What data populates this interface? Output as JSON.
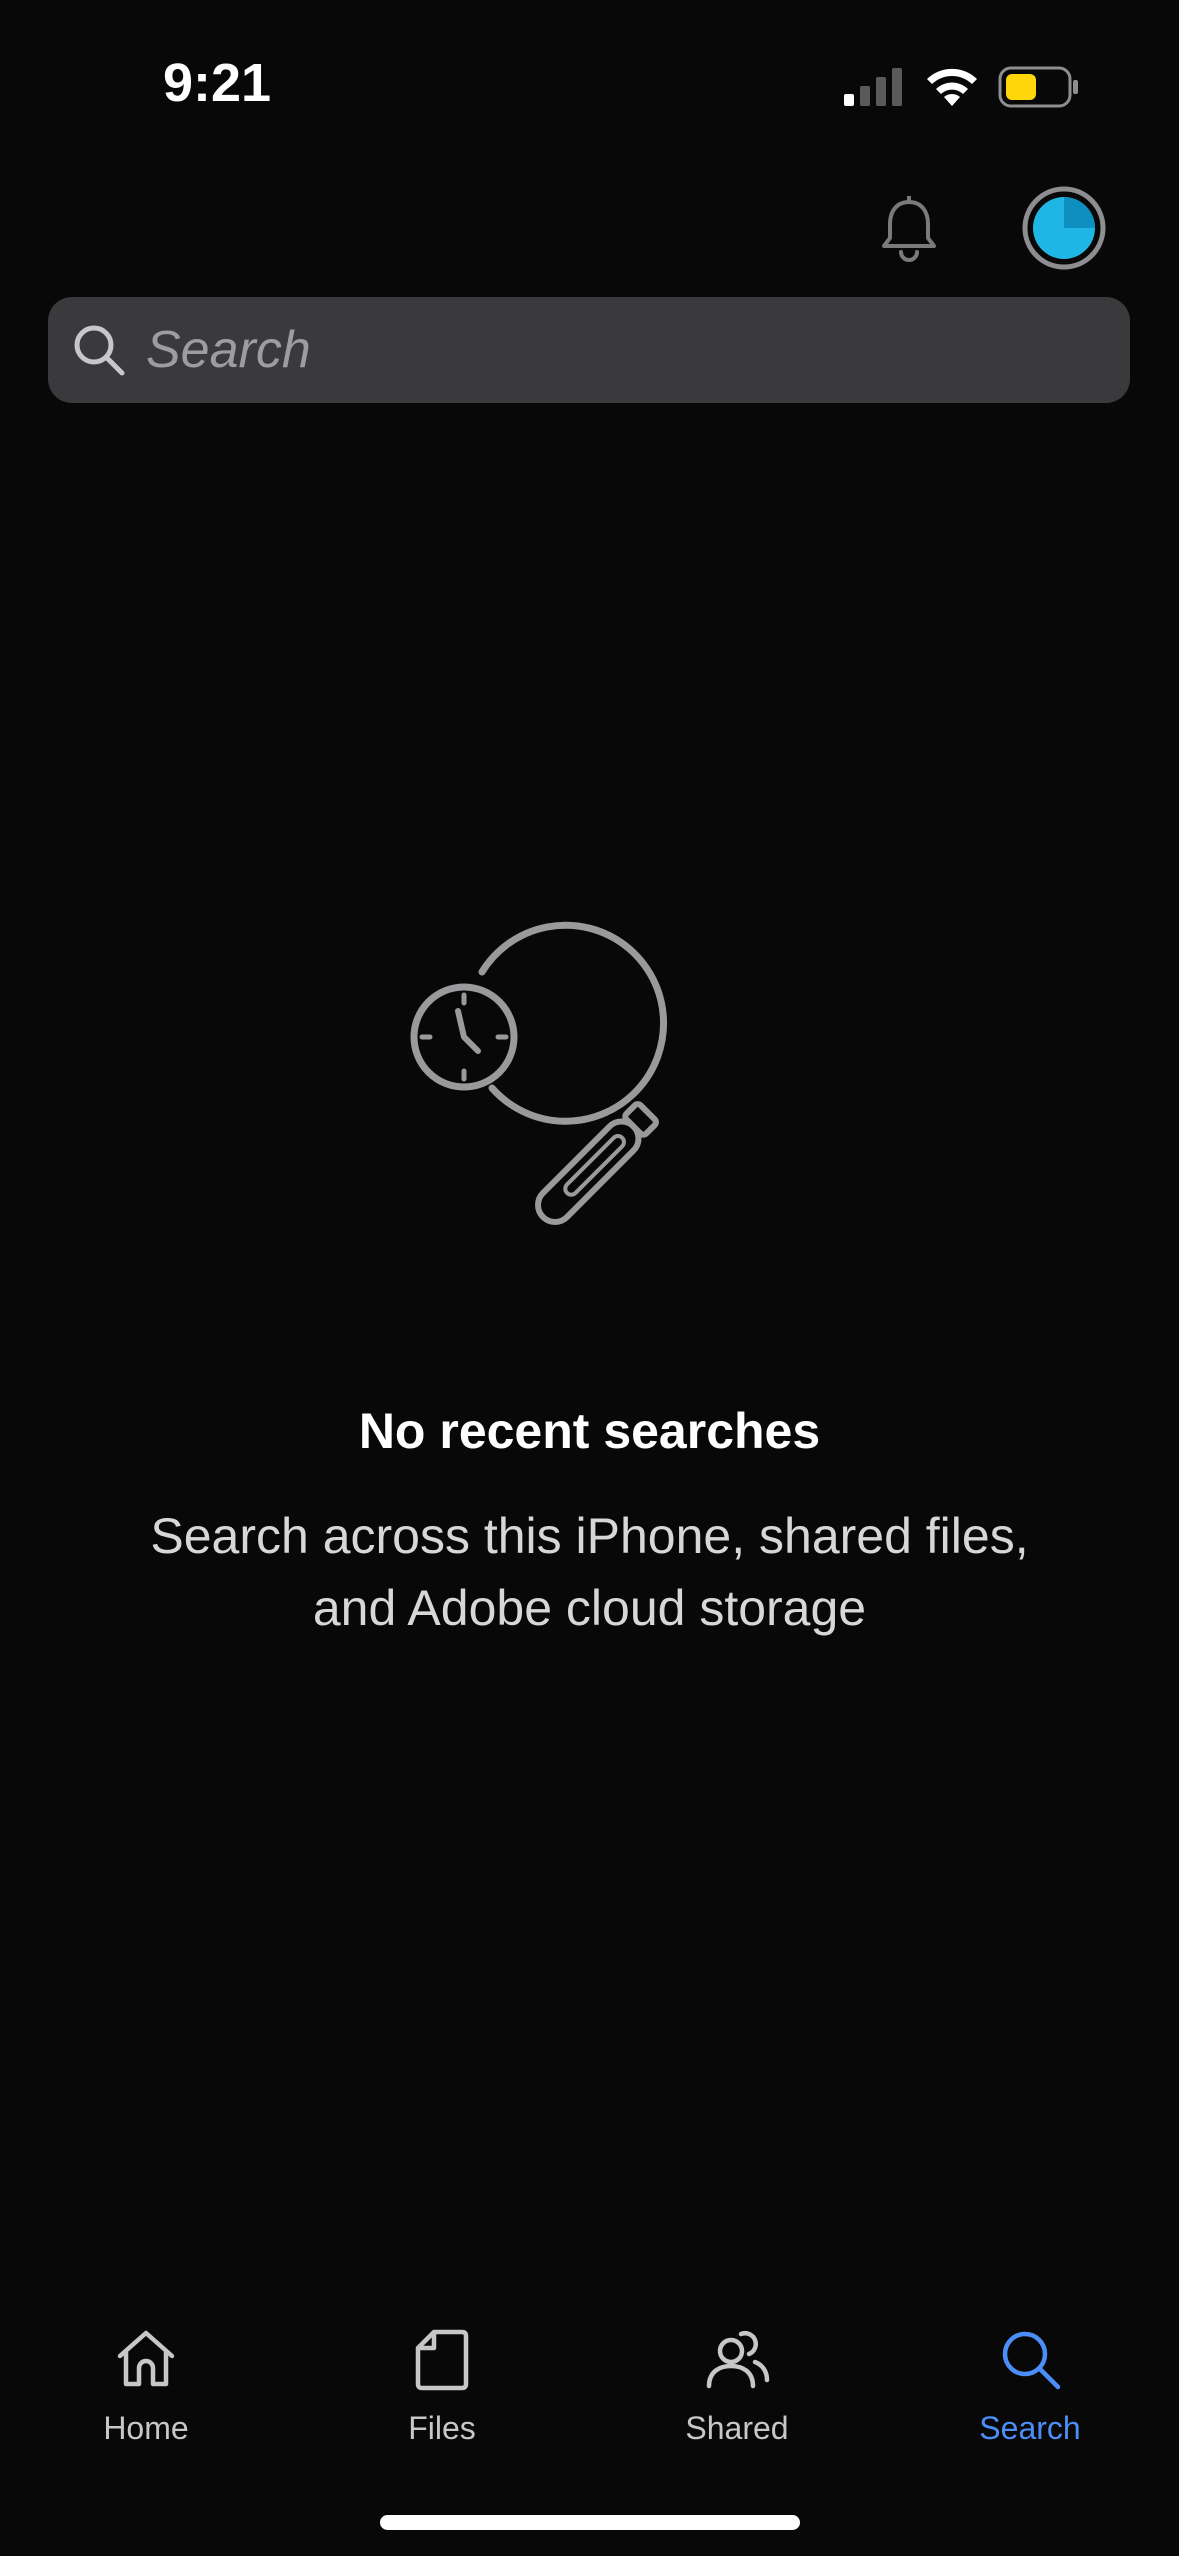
{
  "status_bar": {
    "time": "9:21",
    "battery_color": "#ffd60a"
  },
  "header": {
    "notification_icon": "bell-icon",
    "avatar_color": "#1fb6e6"
  },
  "search": {
    "placeholder": "Search",
    "value": ""
  },
  "empty_state": {
    "illustration": "magnifier-with-clock",
    "title": "No recent searches",
    "subtitle": "Search across this iPhone, shared files, and Adobe cloud storage"
  },
  "tabs": [
    {
      "label": "Home",
      "icon": "home-icon",
      "active": false
    },
    {
      "label": "Files",
      "icon": "file-icon",
      "active": false
    },
    {
      "label": "Shared",
      "icon": "people-icon",
      "active": false
    },
    {
      "label": "Search",
      "icon": "search-icon",
      "active": true
    }
  ],
  "colors": {
    "background": "#080808",
    "search_field": "#3a3a3c",
    "accent": "#4c8ef7"
  }
}
